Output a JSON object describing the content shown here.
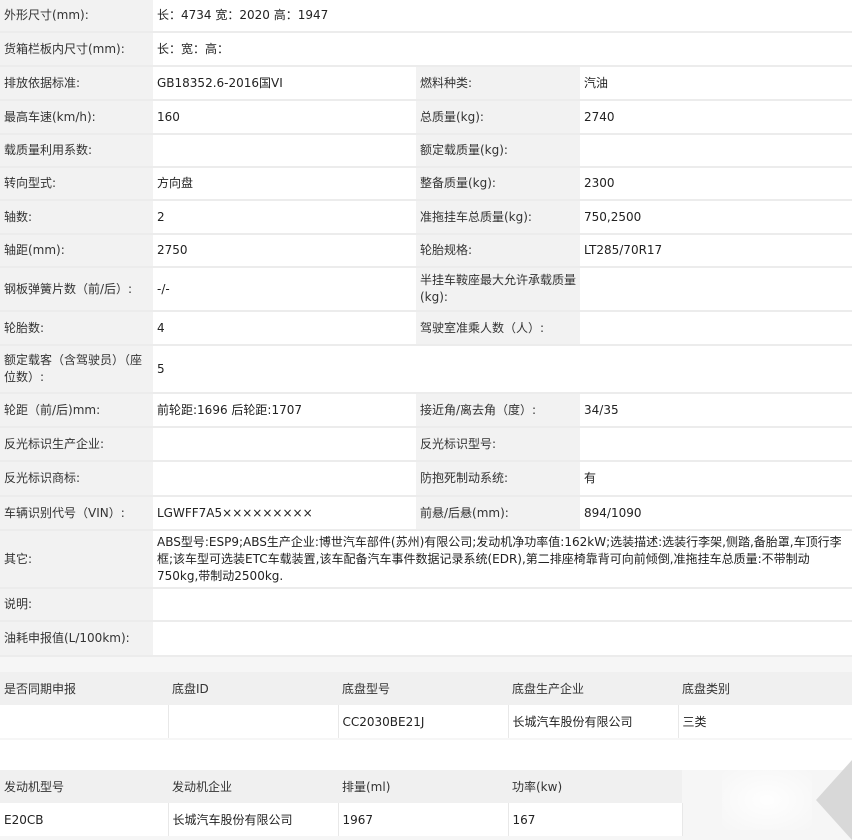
{
  "spec_rows": [
    {
      "l1": "外形尺寸(mm):",
      "v1": "长：4734 宽：2020 高：1947",
      "l2": "",
      "v2": "",
      "span": true
    },
    {
      "l1": "货箱栏板内尺寸(mm):",
      "v1": "长：宽：高：",
      "l2": "",
      "v2": "",
      "span": true
    },
    {
      "l1": "排放依据标准:",
      "v1": "GB18352.6-2016国VI",
      "l2": "燃料种类:",
      "v2": "汽油"
    },
    {
      "l1": "最高车速(km/h):",
      "v1": "160",
      "l2": "总质量(kg):",
      "v2": "2740"
    },
    {
      "l1": "载质量利用系数:",
      "v1": "",
      "l2": "额定载质量(kg):",
      "v2": ""
    },
    {
      "l1": "转向型式:",
      "v1": "方向盘",
      "l2": "整备质量(kg):",
      "v2": "2300"
    },
    {
      "l1": "轴数:",
      "v1": "2",
      "l2": "准拖挂车总质量(kg):",
      "v2": "750,2500"
    },
    {
      "l1": "轴距(mm):",
      "v1": "2750",
      "l2": "轮胎规格:",
      "v2": "LT285/70R17"
    },
    {
      "l1": "钢板弹簧片数（前/后）:",
      "v1": "-/-",
      "l2": "半挂车鞍座最大允许承载质量(kg):",
      "v2": ""
    },
    {
      "l1": "轮胎数:",
      "v1": "4",
      "l2": "驾驶室准乘人数（人）:",
      "v2": ""
    },
    {
      "l1": "额定载客（含驾驶员）（座位数）:",
      "v1": "5",
      "l2": "",
      "v2": "",
      "span": true
    },
    {
      "l1": "轮距（前/后)mm:",
      "v1": "前轮距:1696 后轮距:1707",
      "l2": "接近角/离去角（度）:",
      "v2": "34/35"
    },
    {
      "l1": "反光标识生产企业:",
      "v1": "",
      "l2": "反光标识型号:",
      "v2": ""
    },
    {
      "l1": "反光标识商标:",
      "v1": "",
      "l2": "防抱死制动系统:",
      "v2": "有"
    },
    {
      "l1": "车辆识别代号（VIN）:",
      "v1": "LGWFF7A5×××××××××",
      "l2": "前悬/后悬(mm):",
      "v2": "894/1090"
    },
    {
      "l1": "其它:",
      "v1": "ABS型号:ESP9;ABS生产企业:博世汽车部件(苏州)有限公司;发动机净功率值:162kW;选装描述:选装行李架,侧踏,备胎罩,车顶行李框;该车型可选装ETC车载装置,该车配备汽车事件数据记录系统(EDR),第二排座椅靠背可向前倾倒,准拖挂车总质量:不带制动750kg,带制动2500kg.",
      "l2": "",
      "v2": "",
      "span": true
    },
    {
      "l1": "说明:",
      "v1": "",
      "l2": "",
      "v2": "",
      "span": true
    },
    {
      "l1": "油耗申报值(L/100km):",
      "v1": "",
      "l2": "",
      "v2": "",
      "span": true
    }
  ],
  "chassis": {
    "headers": [
      "是否同期申报",
      "底盘ID",
      "底盘型号",
      "底盘生产企业",
      "底盘类别"
    ],
    "row": [
      "",
      "",
      "CC2030BE21J",
      "长城汽车股份有限公司",
      "三类"
    ]
  },
  "engine": {
    "headers": [
      "发动机型号",
      "发动机企业",
      "排量(ml)",
      "功率(kw)"
    ],
    "row": [
      "E20CB",
      "长城汽车股份有限公司",
      "1967",
      "167"
    ]
  }
}
